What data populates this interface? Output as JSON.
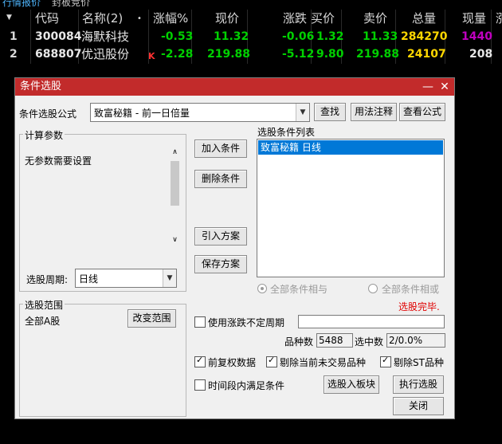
{
  "tabs": [
    "行情报价",
    "封板竞价"
  ],
  "quote_headers": [
    "",
    "代码",
    "名称(2)",
    "•",
    "涨幅%",
    "现价",
    "涨跌",
    "买价",
    "卖价",
    "总量",
    "现量",
    "涨"
  ],
  "quote_rows": [
    {
      "idx": "1",
      "code": "300084",
      "name": "海默科技",
      "mark": "",
      "pct": "-0.53",
      "price": "11.32",
      "chg": "-0.06",
      "bid": "1.32",
      "ask": "11.33",
      "vol": "284270",
      "cur": "1440"
    },
    {
      "idx": "2",
      "code": "688807",
      "name": "优迅股份",
      "mark": "K",
      "pct": "-2.28",
      "price": "219.88",
      "chg": "-5.12",
      "bid": "9.80",
      "ask": "219.88",
      "vol": "24107",
      "cur": "208"
    }
  ],
  "colors": {
    "down": "#00d000",
    "vol": "#ffd700",
    "cur1": "#c000c0",
    "mark": "#ff3030",
    "title_bar": "#c22b2b",
    "selected": "#0078d7",
    "status": "#e00000"
  },
  "dialog": {
    "title": "条件选股",
    "formula_label": "条件选股公式",
    "formula_value": "致富秘籍  -  前一日倍量",
    "find_btn": "查找",
    "usage_btn": "用法注释",
    "view_btn": "查看公式",
    "params_group": "计算参数",
    "params_text": "无参数需要设置",
    "period_label": "选股周期:",
    "period_value": "日线",
    "add_btn": "加入条件",
    "del_btn": "删除条件",
    "import_btn": "引入方案",
    "save_btn": "保存方案",
    "list_label": "选股条件列表",
    "list_items": [
      "致富秘籍  日线"
    ],
    "radio_and": "全部条件相与",
    "radio_or": "全部条件相或",
    "status": "选股完毕.",
    "range_group": "选股范围",
    "range_value": "全部A股",
    "change_range_btn": "改变范围",
    "uncertain_period": "使用涨跌不定周期",
    "count_label": "品种数",
    "count_value": "5488",
    "selected_label": "选中数",
    "selected_value": "2/0.0%",
    "fq_label": "前复权数据",
    "exclude_untraded": "剔除当前未交易品种",
    "exclude_st": "剔除ST品种",
    "time_cond": "时间段内满足条件",
    "to_block_btn": "选股入板块",
    "run_btn": "执行选股",
    "close_btn": "关闭"
  }
}
